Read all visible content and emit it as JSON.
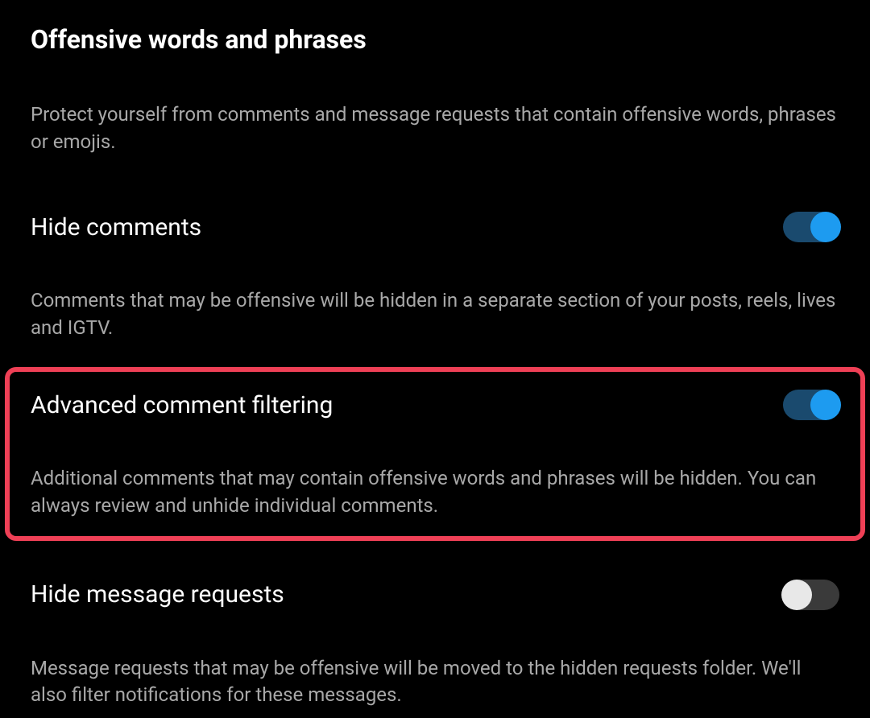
{
  "header": {
    "title": "Offensive words and phrases",
    "subtitle": "Protect yourself from comments and message requests that contain offensive words, phrases or emojis."
  },
  "settings": [
    {
      "label": "Hide comments",
      "description": "Comments that may be offensive will be hidden in a separate section of your posts, reels, lives and IGTV.",
      "enabled": true
    },
    {
      "label": "Advanced comment filtering",
      "description": "Additional comments that may contain offensive words and phrases will be hidden. You can always review and unhide individual comments.",
      "enabled": true
    },
    {
      "label": "Hide message requests",
      "description": "Message requests that may be offensive will be moved to the hidden requests folder. We'll also filter notifications for these messages.",
      "enabled": false
    }
  ]
}
